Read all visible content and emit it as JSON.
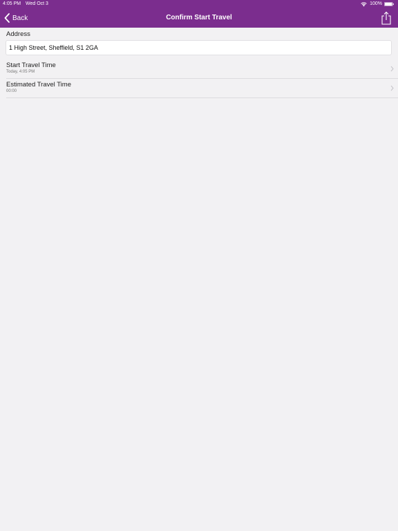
{
  "status_bar": {
    "time": "4:05 PM",
    "date": "Wed Oct 3",
    "battery_percent": "100%"
  },
  "nav": {
    "back_label": "Back",
    "title": "Confirm Start Travel"
  },
  "address": {
    "label": "Address",
    "value": "1 High Street, Sheffield, S1 2GA"
  },
  "rows": [
    {
      "title": "Start Travel Time",
      "subtitle": "Today, 4:05 PM"
    },
    {
      "title": "Estimated Travel Time",
      "subtitle": "00:00"
    }
  ],
  "colors": {
    "nav_background": "#7b2d8e",
    "page_background": "#f2f1f3"
  }
}
